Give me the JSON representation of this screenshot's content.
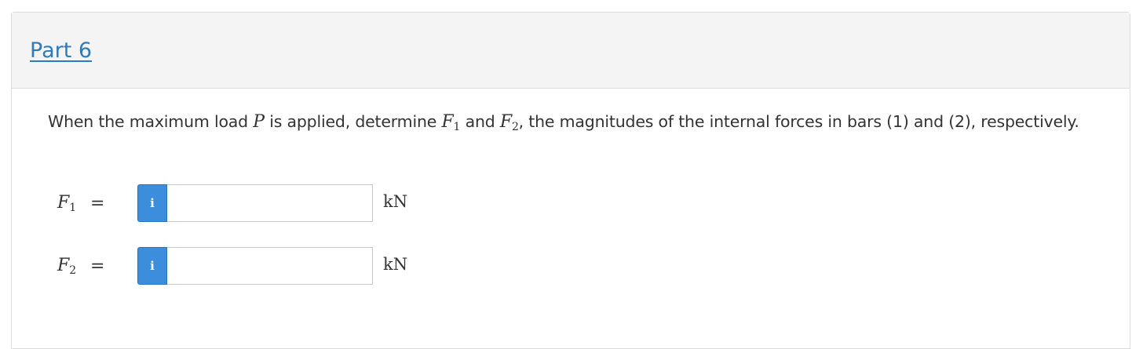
{
  "part": {
    "link_label": "Part 6"
  },
  "question": {
    "text_1": "When the maximum load ",
    "var_p": "P",
    "text_2": " is applied, determine ",
    "var_f1": "F",
    "sub_1": "1",
    "text_3": " and ",
    "var_f2": "F",
    "sub_2": "2",
    "text_4": ", the magnitudes of the internal forces in bars (1) and (2), respectively."
  },
  "answers": [
    {
      "label": "F",
      "subscript": "1",
      "equals": "=",
      "info_icon": "info-icon",
      "info_glyph": "i",
      "value": "",
      "unit": "kN"
    },
    {
      "label": "F",
      "subscript": "2",
      "equals": "=",
      "info_icon": "info-icon",
      "info_glyph": "i",
      "value": "",
      "unit": "kN"
    }
  ],
  "colors": {
    "link": "#2f7ab8",
    "header_bg": "#f4f4f4",
    "info_button": "#3c8ddc",
    "text": "#333333"
  }
}
